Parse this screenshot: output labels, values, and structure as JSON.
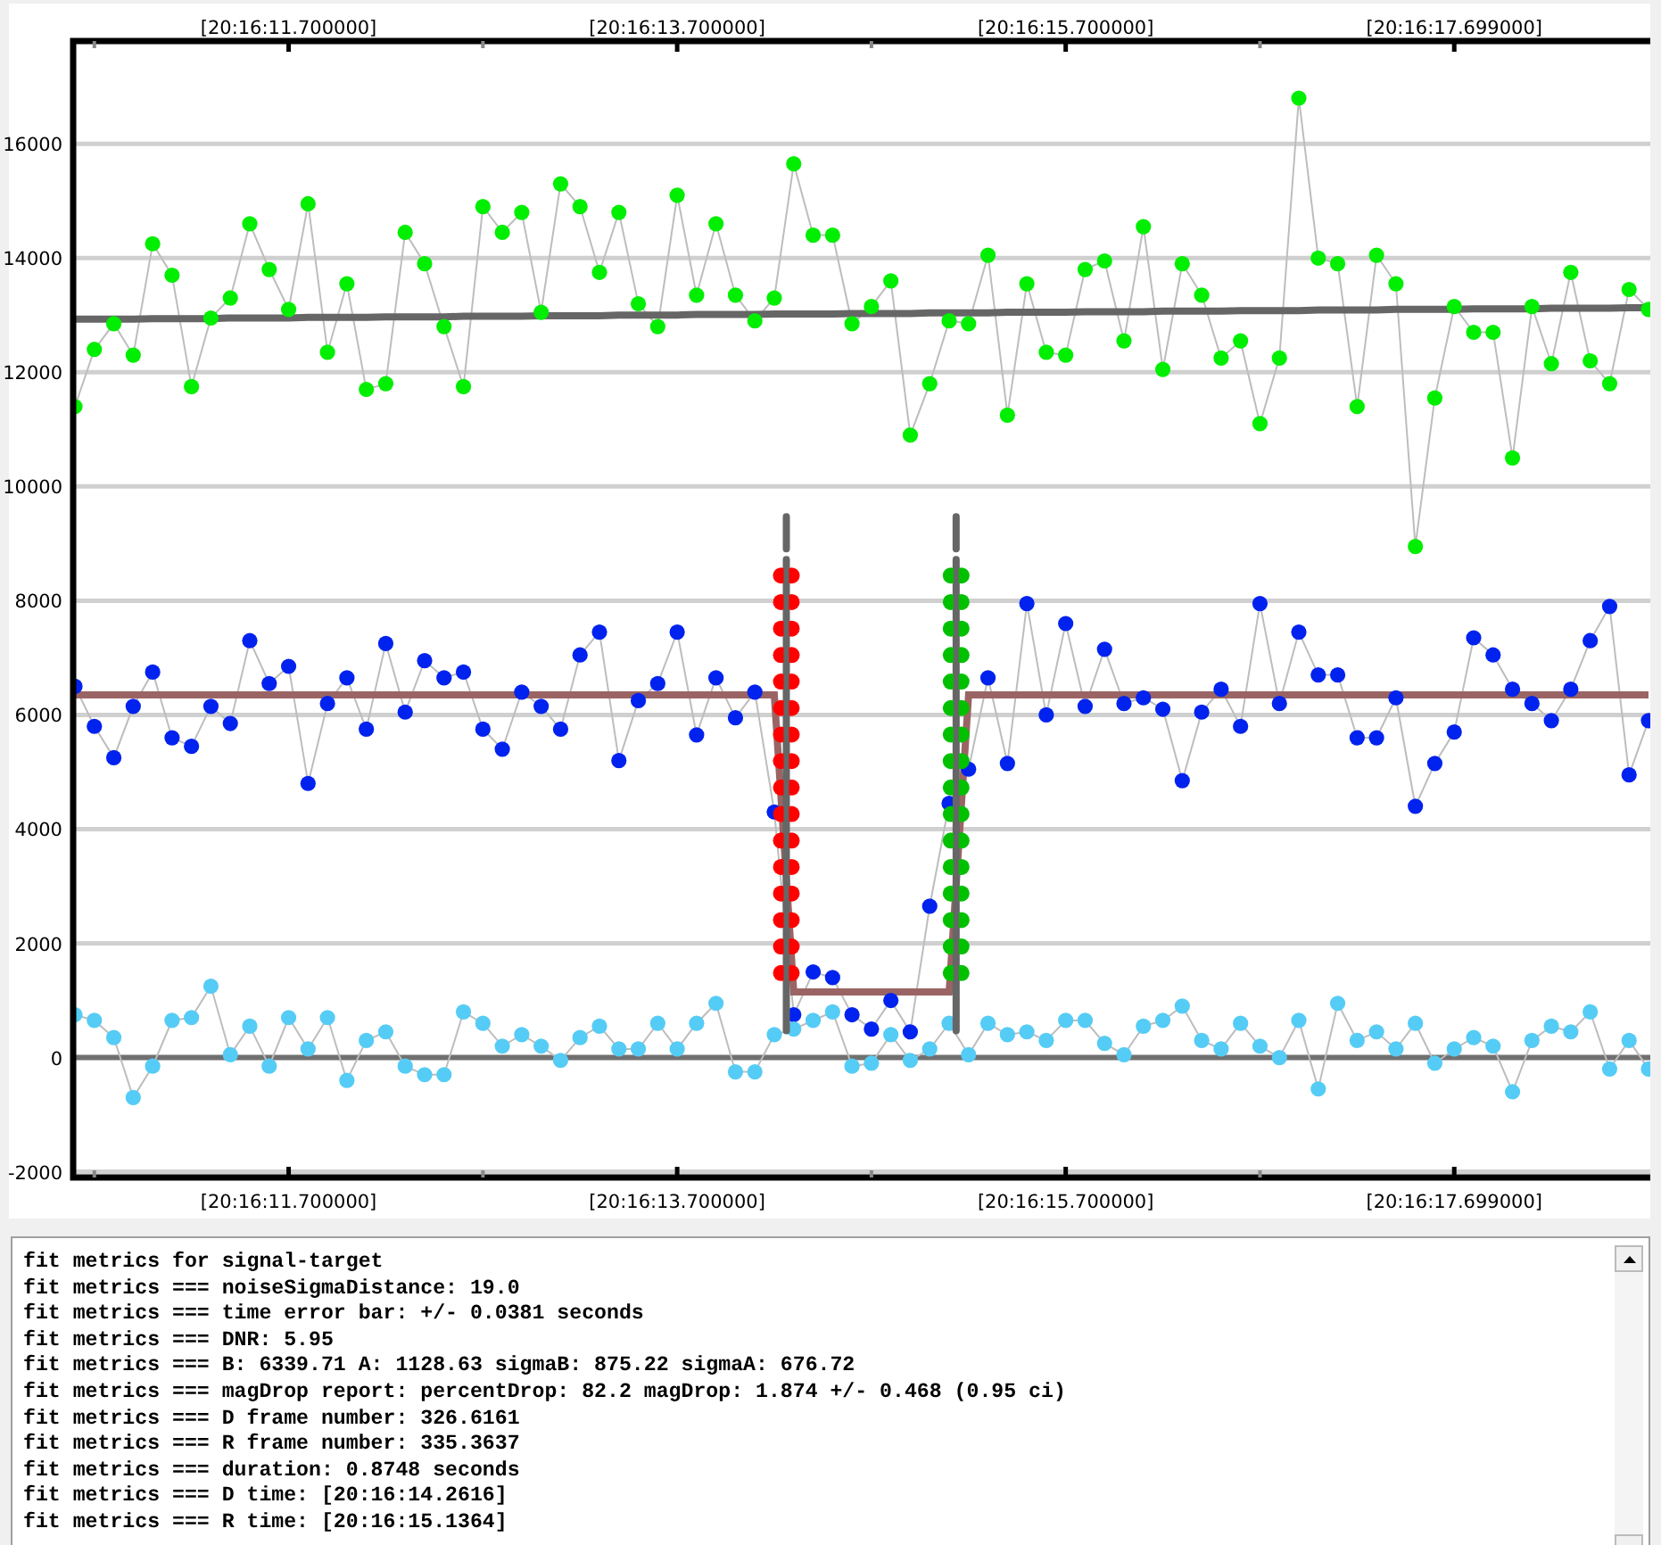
{
  "chart": {
    "top_axis_labels": [
      "[20:16:11.700000]",
      "[20:16:13.700000]",
      "[20:16:15.700000]",
      "[20:16:17.699000]"
    ],
    "chart_data": {
      "type": "line",
      "grid": true,
      "categories": [
        null,
        null,
        null,
        null,
        null,
        null,
        null,
        null,
        null,
        null,
        null,
        "[20:16:11.700000]",
        null,
        null,
        null,
        null,
        null,
        null,
        null,
        null,
        null,
        null,
        null,
        null,
        null,
        null,
        null,
        null,
        null,
        null,
        null,
        "[20:16:13.700000]",
        null,
        null,
        null,
        null,
        null,
        null,
        null,
        null,
        null,
        null,
        null,
        null,
        null,
        null,
        null,
        null,
        null,
        null,
        null,
        "[20:16:15.700000]",
        null,
        null,
        null,
        null,
        null,
        null,
        null,
        null,
        null,
        null,
        null,
        null,
        null,
        null,
        null,
        null,
        null,
        null,
        null,
        "[20:16:17.699000]",
        null,
        null,
        null,
        null,
        null,
        null,
        null,
        null,
        null,
        null
      ],
      "ylim": [
        -2100,
        17800
      ],
      "yticks": [
        -2000,
        0,
        2000,
        4000,
        6000,
        8000,
        10000,
        12000,
        14000,
        16000
      ],
      "series": [
        {
          "type": "line",
          "marker": true,
          "color": "#00ee00",
          "values": [
            11400,
            12400,
            12850,
            12300,
            14250,
            13700,
            11750,
            12950,
            13300,
            14600,
            13800,
            13100,
            14950,
            12350,
            13550,
            11700,
            11800,
            14450,
            13900,
            12800,
            11750,
            14900,
            14450,
            14800,
            13050,
            15300,
            14900,
            13750,
            14800,
            13200,
            12800,
            15100,
            13350,
            14600,
            13350,
            12900,
            13300,
            15650,
            14400,
            14400,
            12850,
            13150,
            13600,
            10900,
            11800,
            12900,
            12850,
            14050,
            11250,
            13550,
            12350,
            12300,
            13800,
            13950,
            12550,
            14550,
            12050,
            13900,
            13350,
            12250,
            12550,
            11100,
            12250,
            16800,
            14000,
            13900,
            11400,
            14050,
            13550,
            8950,
            11550,
            13150,
            12700,
            12700,
            10500,
            13150,
            12150,
            13750,
            12200,
            11800,
            13450,
            13100
          ]
        },
        {
          "type": "line",
          "marker": true,
          "color": "#0022ee",
          "values": [
            6500,
            5800,
            5250,
            6150,
            6750,
            5600,
            5450,
            6150,
            5850,
            7300,
            6550,
            6850,
            4800,
            6200,
            6650,
            5750,
            7250,
            6050,
            6950,
            6650,
            6750,
            5750,
            5400,
            6400,
            6150,
            5750,
            7050,
            7450,
            5200,
            6250,
            6550,
            7450,
            5650,
            6650,
            5950,
            6400,
            4300,
            750,
            1500,
            1400,
            750,
            500,
            1000,
            450,
            2650,
            4450,
            5050,
            6650,
            5150,
            7950,
            6000,
            7600,
            6150,
            7150,
            6200,
            6300,
            6100,
            4850,
            6050,
            6450,
            5800,
            7950,
            6200,
            7450,
            6700,
            6700,
            5600,
            5600,
            6300,
            4400,
            5150,
            5700,
            7350,
            7050,
            6450,
            6200,
            5900,
            6450,
            7300,
            7900,
            4950,
            5900
          ]
        },
        {
          "type": "line",
          "marker": true,
          "color": "#55ccf5",
          "values": [
            750,
            650,
            350,
            -700,
            -150,
            650,
            700,
            1250,
            50,
            550,
            -150,
            700,
            150,
            700,
            -400,
            300,
            450,
            -150,
            -300,
            -300,
            800,
            600,
            200,
            400,
            200,
            -50,
            350,
            550,
            150,
            150,
            600,
            150,
            600,
            950,
            -250,
            -250,
            400,
            500,
            650,
            800,
            -150,
            -100,
            400,
            -50,
            150,
            600,
            50,
            600,
            400,
            450,
            300,
            650,
            650,
            250,
            50,
            550,
            650,
            900,
            300,
            150,
            600,
            200,
            0,
            650,
            -550,
            950,
            300,
            450,
            150,
            600,
            -100,
            150,
            350,
            200,
            -600,
            300,
            550,
            450,
            800,
            -200,
            300,
            -200
          ]
        },
        {
          "type": "line",
          "color": "#666666",
          "values": [
            12930,
            12930,
            12930,
            12930,
            12940,
            12940,
            12940,
            12940,
            12950,
            12950,
            12950,
            12950,
            12960,
            12960,
            12960,
            12960,
            12970,
            12970,
            12970,
            12970,
            12980,
            12980,
            12980,
            12980,
            12990,
            12990,
            12990,
            12990,
            13000,
            13000,
            13000,
            13000,
            13010,
            13010,
            13010,
            13010,
            13020,
            13020,
            13020,
            13020,
            13030,
            13030,
            13030,
            13030,
            13040,
            13040,
            13040,
            13040,
            13050,
            13050,
            13050,
            13050,
            13060,
            13060,
            13060,
            13060,
            13070,
            13070,
            13070,
            13070,
            13080,
            13080,
            13080,
            13080,
            13090,
            13090,
            13090,
            13090,
            13100,
            13100,
            13100,
            13100,
            13110,
            13110,
            13110,
            13110,
            13120,
            13120,
            13120,
            13120,
            13130,
            13130
          ]
        },
        {
          "type": "line",
          "color": "#9b6464",
          "values": [
            6350,
            6350,
            6350,
            6350,
            6350,
            6350,
            6350,
            6350,
            6350,
            6350,
            6350,
            6350,
            6350,
            6350,
            6350,
            6350,
            6350,
            6350,
            6350,
            6350,
            6350,
            6350,
            6350,
            6350,
            6350,
            6350,
            6350,
            6350,
            6350,
            6350,
            6350,
            6350,
            6350,
            6350,
            6350,
            6350,
            6350,
            1150,
            1150,
            1150,
            1150,
            1150,
            1150,
            1150,
            1150,
            1150,
            6350,
            6350,
            6350,
            6350,
            6350,
            6350,
            6350,
            6350,
            6350,
            6350,
            6350,
            6350,
            6350,
            6350,
            6350,
            6350,
            6350,
            6350,
            6350,
            6350,
            6350,
            6350,
            6350,
            6350,
            6350,
            6350,
            6350,
            6350,
            6350,
            6350,
            6350,
            6350,
            6350,
            6350,
            6350,
            6350
          ]
        }
      ]
    }
  },
  "log": {
    "lines": [
      "fit metrics for signal-target",
      "fit metrics === noiseSigmaDistance: 19.0",
      "fit metrics === time error bar: +/- 0.0381 seconds",
      "fit metrics === DNR: 5.95",
      "fit metrics === B: 6339.71 A: 1128.63 sigmaB: 875.22 sigmaA: 676.72",
      "fit metrics === magDrop report: percentDrop: 82.2 magDrop: 1.874 +/- 0.468 (0.95 ci)",
      "fit metrics === D frame number: 326.6161",
      "fit metrics === R frame number: 335.3637",
      "fit metrics === duration: 0.8748 seconds",
      "fit metrics === D time: [20:16:14.2616]",
      "fit metrics === R time: [20:16:15.1364]"
    ]
  }
}
